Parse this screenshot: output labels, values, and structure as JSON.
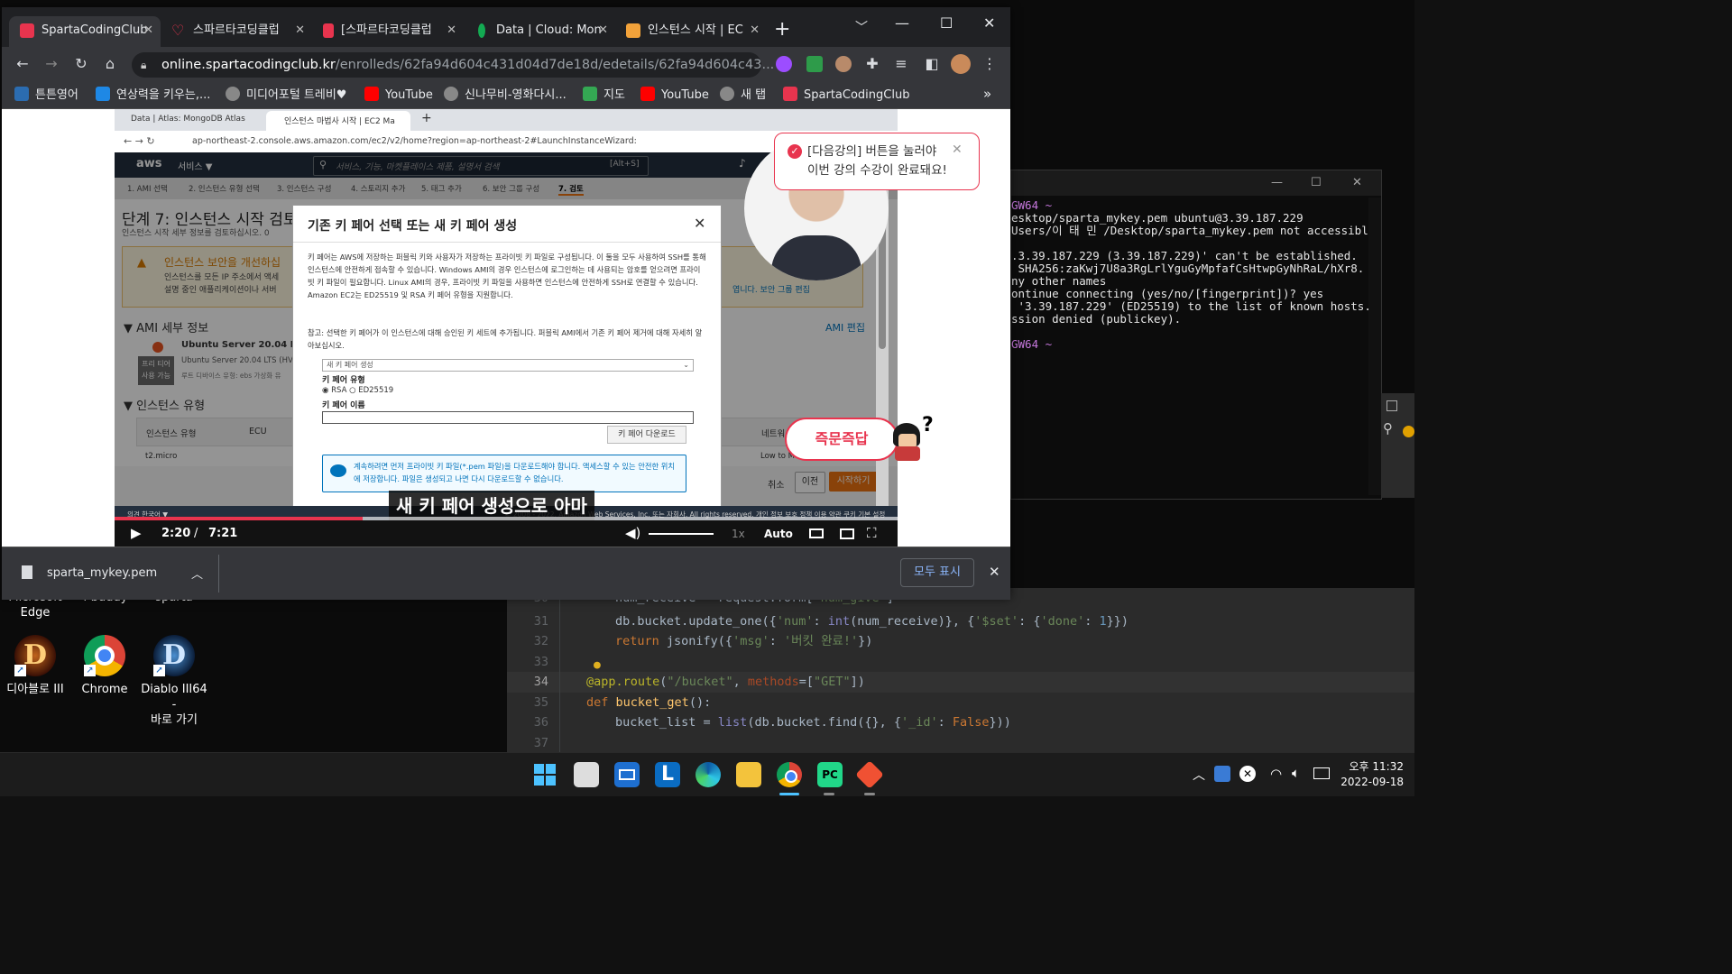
{
  "desktop": {
    "icons": [
      {
        "label": "Microsoft\nEdge",
        "label_top": "Microsoft",
        "label_bottom": "Edge"
      },
      {
        "label": "i-buddy"
      },
      {
        "label": "sparta"
      },
      {
        "label": "디아블로 III"
      },
      {
        "label": "Chrome"
      },
      {
        "label_top": "Diablo III64 -",
        "label_bottom": "바로 가기"
      }
    ]
  },
  "terminal": {
    "lines": [
      "GW64 ~",
      "esktop/sparta_mykey.pem ubuntu@3.39.187.229",
      "Users/이 태 민 /Desktop/sparta_mykey.pem not accessible:",
      "",
      ".3.39.187.229 (3.39.187.229)' can't be established.",
      " SHA256:zaKwj7U8a3RgLrlYguGyMpfafCsHtwpGyNhRaL/hXr8.",
      "ny other names",
      "ontinue connecting (yes/no/[fingerprint])? yes",
      " '3.39.187.229' (ED25519) to the list of known hosts.",
      "ssion denied (publickey).",
      "",
      "GW64 ~"
    ]
  },
  "editor": {
    "lines": [
      {
        "n": "30",
        "code": "num_receive = request.form['num_give']"
      },
      {
        "n": "31",
        "code": "db.bucket.update_one({'num': int(num_receive)}, {'$set': {'done': 1}})"
      },
      {
        "n": "32",
        "code": "return jsonify({'msg': '버킷 완료!'})"
      },
      {
        "n": "33",
        "code": ""
      },
      {
        "n": "34",
        "code": "@app.route(\"/bucket\", methods=[\"GET\"])"
      },
      {
        "n": "35",
        "code": "def bucket_get():"
      },
      {
        "n": "36",
        "code": "bucket_list = list(db.bucket.find({}, {'_id': False}))"
      },
      {
        "n": "37",
        "code": ""
      }
    ]
  },
  "taskbar": {
    "time": "오후 11:32",
    "date": "2022-09-18"
  },
  "chrome": {
    "tabs": [
      {
        "title": "SpartaCodingClub",
        "color": "#e8344e",
        "active": true
      },
      {
        "title": "스파르타코딩클럽",
        "color": "#e8344e"
      },
      {
        "title": "[스파르타코딩클럽",
        "color": "#e8344e"
      },
      {
        "title": "Data | Cloud: Mon",
        "color": "#13aa52"
      },
      {
        "title": "인스턴스 시작 | EC",
        "color": "#f90"
      }
    ],
    "new_tab": "+",
    "url_host": "online.spartacodingclub.kr",
    "url_path": "/enrolleds/62fa94d604c431d04d7de18d/edetails/62fa94d604c43...",
    "bookmarks": [
      {
        "label": "튼튼영어",
        "color": "#2b6cb0"
      },
      {
        "label": "연상력을 키우는,...",
        "color": "#1e88e5"
      },
      {
        "label": "미디어포털 트레비♥",
        "color": "#888"
      },
      {
        "label": "YouTube",
        "color": "#ff0000"
      },
      {
        "label": "신나무비-영화다시...",
        "color": "#888"
      },
      {
        "label": "지도",
        "color": "#34a853"
      },
      {
        "label": "YouTube",
        "color": "#ff0000"
      },
      {
        "label": "새 탭",
        "color": "#888"
      },
      {
        "label": "SpartaCodingClub",
        "color": "#e8344e"
      }
    ],
    "bookmarks_more": "»"
  },
  "video": {
    "inner_tabs": [
      "Data | Atlas: MongoDB Atlas",
      "인스턴스 마법사 시작 | EC2 Ma"
    ],
    "inner_url": "ap-northeast-2.console.aws.amazon.com/ec2/v2/home?region=ap-northeast-2#LaunchInstanceWizard:",
    "aws_services": "서비스 ▼",
    "aws_search": "서비스, 기능, 마켓플레이스 제품, 설명서 검색",
    "aws_search_shortcut": "[Alt+S]",
    "steps": [
      "1. AMI 선택",
      "2. 인스턴스 유형 선택",
      "3. 인스턴스 구성",
      "4. 스토리지 추가",
      "5. 태그 추가",
      "6. 보안 그룹 구성",
      "7. 검토"
    ],
    "page_title": "단계 7: 인스턴스 시작 검토",
    "page_sub": "인스턴스 시작 세부 정보를 검토하십시오. 0",
    "warning_title": "인스턴스 보안을 개선하십",
    "warning_text1": "인스턴스를 모든 IP 주소에서 액세",
    "warning_text2": "설명 중인 애플리케이션이나 서버",
    "ami_section": "AMI 세부 정보",
    "ami_edit": "AMI 편집",
    "ami_name": "Ubuntu Server 20.04 LTS",
    "ami_desc": "Ubuntu Server 20.04 LTS (HVM",
    "ami_root": "루트 디바이스 유형: ebs  가상화 유",
    "free_tier": "프리 티어 사용 가능",
    "instance_section": "인스턴스 유형",
    "col_instance": "인스턴스 유형",
    "col_ecu": "ECU",
    "col_network": "네트워",
    "row_instance": "t2.micro",
    "row_network": "Low to Moderate",
    "security_edit": "엽니다. 보안 그룹 편집",
    "cancel": "취소",
    "prev": "이전",
    "launch": "시작하기",
    "modal_title": "기존 키 페어 선택 또는 새 키 페어 생성",
    "modal_p1": "키 페어는 AWS에 저장하는 퍼블릭 키와 사용자가 저장하는 프라이빗 키 파일로 구성됩니다. 이 둘을 모두 사용하여 SSH를 통해 인스턴스에 안전하게 접속할 수 있습니다. Windows AMI의 경우 인스턴스에 로그인하는 데 사용되는 암호를 얻으려면 프라이빗 키 파일이 필요합니다. Linux AMI의 경우, 프라이빗 키 파일을 사용하면 인스턴스에 안전하게 SSH로 연결할 수 있습니다. Amazon EC2는 ED25519 및 RSA 키 페어 유형을 지원합니다.",
    "modal_p2": "참고: 선택한 키 페어가 이 인스턴스에 대해 승인된 키 세트에 추가됩니다. 퍼블릭 AMI에서 기존 키 페어 제거에 대해 자세히 알아보십시오.",
    "modal_select": "새 키 페어 생성",
    "modal_type_label": "키 페어 유형",
    "modal_rsa": "RSA",
    "modal_ed": "ED25519",
    "modal_name_label": "키 페어 이름",
    "modal_download": "키 페어 다운로드",
    "modal_info": "계속하려면 먼저 프라이빗 키 파일(*.pem 파일)을 다운로드해야 합니다. 액세스할 수 있는 안전한 위치에 저장합니다. 파일은 생성되고 나면 다시 다운로드할 수 없습니다.",
    "subtitle": "새 키 페어 생성으로 아마",
    "notice_line1": "[다음강의] 버튼을 눌러야",
    "notice_line2": "이번 강의 수강이 완료돼요!",
    "qa_badge": "즉문즉답",
    "footer_left": "의견  한국어 ▼",
    "footer_right": "© 2008 - 2022, Amazon Web Services, Inc. 또는 자회사. All rights reserved.  개인 정보 보호 정책  이용 약관  쿠키 기본 설정",
    "time_current": "2:20",
    "time_sep": "/",
    "time_total": "7:21",
    "speed": "1x",
    "quality": "Auto",
    "progress": 0.317
  },
  "download": {
    "filename": "sparta_mykey.pem",
    "show_all": "모두 표시"
  }
}
